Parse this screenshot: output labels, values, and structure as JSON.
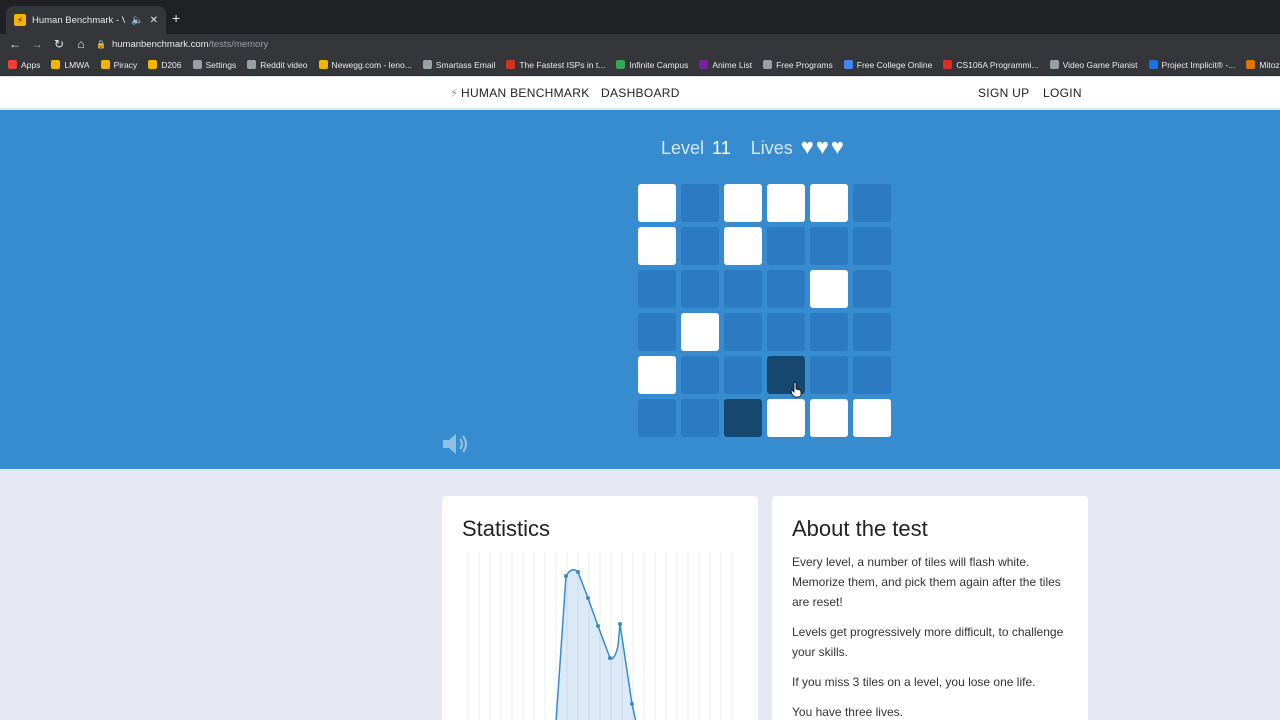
{
  "browser": {
    "tab_title": "Human Benchmark - Visual M",
    "tab_favicon": "⚡",
    "url_domain": "humanbenchmark.com",
    "url_path": "/tests/memory",
    "bookmarks": [
      {
        "label": "Apps",
        "color": "#ea4335"
      },
      {
        "label": "LMWA",
        "color": "#f4b400"
      },
      {
        "label": "Piracy",
        "color": "#f4b400"
      },
      {
        "label": "D206",
        "color": "#f4b400"
      },
      {
        "label": "Settings",
        "color": "#9aa0a6"
      },
      {
        "label": "Reddit video",
        "color": "#9aa0a6"
      },
      {
        "label": "Newegg.com - leno...",
        "color": "#f4b400"
      },
      {
        "label": "Smartass Email",
        "color": "#9aa0a6"
      },
      {
        "label": "The Fastest ISPs in t...",
        "color": "#d93025"
      },
      {
        "label": "Infinite Campus",
        "color": "#34a853"
      },
      {
        "label": "Anime List",
        "color": "#7b1fa2"
      },
      {
        "label": "Free Programs",
        "color": "#9aa0a6"
      },
      {
        "label": "Free College Online",
        "color": "#4285f4"
      },
      {
        "label": "CS106A Programmi...",
        "color": "#d93025"
      },
      {
        "label": "Video Game Pianist",
        "color": "#9aa0a6"
      },
      {
        "label": "Project Implicit® -...",
        "color": "#1a73e8"
      },
      {
        "label": "Mitoza",
        "color": "#e37400"
      }
    ]
  },
  "site": {
    "brand": "HUMAN BENCHMARK",
    "dashboard": "DASHBOARD",
    "signup": "SIGN UP",
    "login": "LOGIN"
  },
  "game": {
    "level_label": "Level",
    "level_value": "11",
    "lives_label": "Lives",
    "lives_count": 3,
    "grid": [
      [
        1,
        0,
        1,
        1,
        1,
        0
      ],
      [
        1,
        0,
        1,
        0,
        0,
        0
      ],
      [
        0,
        0,
        0,
        0,
        1,
        0
      ],
      [
        0,
        1,
        0,
        0,
        0,
        0
      ],
      [
        1,
        0,
        0,
        2,
        0,
        0
      ],
      [
        0,
        0,
        2,
        1,
        1,
        1
      ]
    ],
    "colors": {
      "tile": "#2b7ac2",
      "revealed": "#ffffff",
      "missed": "#16476e",
      "background": "#378ccf"
    }
  },
  "statistics": {
    "title": "Statistics"
  },
  "about": {
    "title": "About the test",
    "paragraphs": [
      "Every level, a number of tiles will flash white. Memorize them, and pick them again after the tiles are reset!",
      "Levels get progressively more difficult, to challenge your skills.",
      "If you miss 3 tiles on a level, you lose one life.",
      "You have three lives."
    ]
  }
}
